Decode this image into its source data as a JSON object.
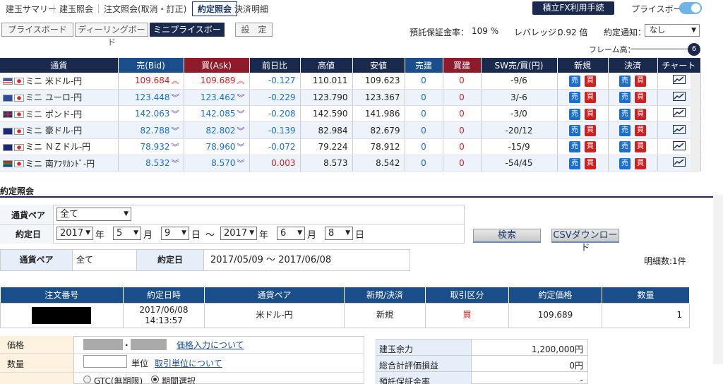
{
  "topnav": {
    "items": [
      "建玉サマリー",
      "建玉照会",
      "注文照会(取消・訂正)",
      "約定照会",
      "決済明細"
    ],
    "active": "約定照会",
    "fx_button": "積立FX利用手続",
    "priceboard_label": "プライスボード"
  },
  "tabs": [
    "プライスボード",
    "ディーリングボード",
    "ミニプライスボード",
    "設　定"
  ],
  "status": {
    "margin_rate_label": "預託保証金率：",
    "margin_rate_value": "109 %",
    "leverage_label": "レバレッジ：",
    "leverage_value": "0.92 倍",
    "notify_label": "約定通知：",
    "notify_value": "なし"
  },
  "frame": {
    "label": "フレーム高：",
    "value": "6"
  },
  "rate_table": {
    "headers": [
      "通貨",
      "売(Bid)",
      "買(Ask)",
      "前日比",
      "高値",
      "安値",
      "売建",
      "買建",
      "SW売/買(円)",
      "新規",
      "決済",
      "チャート"
    ],
    "rows": [
      {
        "flag": "us",
        "pair": "ミニ 米ドル-円",
        "bid": "109.684",
        "ask": "109.689",
        "dir": "up",
        "change": "-0.127",
        "high": "110.011",
        "low": "109.623",
        "sell": "0",
        "buy": "0",
        "sw": "-9/6"
      },
      {
        "flag": "eu",
        "pair": "ミニ ユーロ-円",
        "bid": "123.448",
        "ask": "123.462",
        "dir": "down",
        "change": "-0.229",
        "high": "123.790",
        "low": "123.367",
        "sell": "0",
        "buy": "0",
        "sw": "3/-6"
      },
      {
        "flag": "gb",
        "pair": "ミニ ポンド-円",
        "bid": "142.063",
        "ask": "142.085",
        "dir": "down",
        "change": "-0.208",
        "high": "142.590",
        "low": "141.986",
        "sell": "0",
        "buy": "0",
        "sw": "-3/0"
      },
      {
        "flag": "au",
        "pair": "ミニ 豪ドル-円",
        "bid": "82.788",
        "ask": "82.802",
        "dir": "down",
        "change": "-0.139",
        "high": "82.984",
        "low": "82.679",
        "sell": "0",
        "buy": "0",
        "sw": "-20/12"
      },
      {
        "flag": "nz",
        "pair": "ミニ ＮＺドル-円",
        "bid": "78.932",
        "ask": "78.960",
        "dir": "down",
        "change": "-0.072",
        "high": "79.224",
        "low": "78.912",
        "sell": "0",
        "buy": "0",
        "sw": "-15/9"
      },
      {
        "flag": "za",
        "pair": "ミニ 南ｱﾌﾘｶﾝﾄﾞ-円",
        "bid": "8.532",
        "ask": "8.570",
        "dir": "down",
        "change": "0.003",
        "high": "8.573",
        "low": "8.542",
        "sell": "0",
        "buy": "0",
        "sw": "-54/45"
      }
    ],
    "sell_btn": "売",
    "buy_btn": "買"
  },
  "section_title": "約定照会",
  "search": {
    "pair_label": "通貨ペア",
    "pair_value": "全て",
    "date_label": "約定日",
    "from": {
      "year": "2017",
      "month": "5",
      "day": "9"
    },
    "to": {
      "year": "2017",
      "month": "6",
      "day": "8"
    },
    "year_unit": "年",
    "month_unit": "月",
    "day_unit": "日",
    "tilde": "～",
    "search_btn": "検索",
    "csv_btn": "CSVダウンロード"
  },
  "conditions": {
    "pair_label": "通貨ペア",
    "pair_value": "全て",
    "date_label": "約定日",
    "date_value": "2017/05/09 ～ 2017/06/08",
    "count": "明細数:1件"
  },
  "results": {
    "headers": [
      "注文番号",
      "約定日時",
      "通貨ペア",
      "新規/決済",
      "取引区分",
      "約定価格",
      "数量"
    ],
    "rows": [
      {
        "order_no": "",
        "date": "2017/06/08",
        "time": "14:13:57",
        "pair": "米ドル-円",
        "type": "新規",
        "side": "買",
        "price": "109.689",
        "qty": "1"
      }
    ]
  },
  "order_form": {
    "price_label": "価格",
    "price_link": "価格入力について",
    "qty_label": "数量",
    "unit": "単位",
    "unit_link": "取引単位について",
    "gtc": "GTC(無期限)",
    "period": "期間選択"
  },
  "account": {
    "rows": [
      {
        "label": "建玉余力",
        "value": "1,200,000円"
      },
      {
        "label": "総合計評価損益",
        "value": "0円"
      },
      {
        "label": "預託保証金率",
        "value": "-"
      }
    ]
  },
  "colors": {
    "navy": "#1a2a4e",
    "bid": "#1a4e8a",
    "ask": "#8e1a2a",
    "blue": "#1a6fd0",
    "red": "#d02020"
  }
}
